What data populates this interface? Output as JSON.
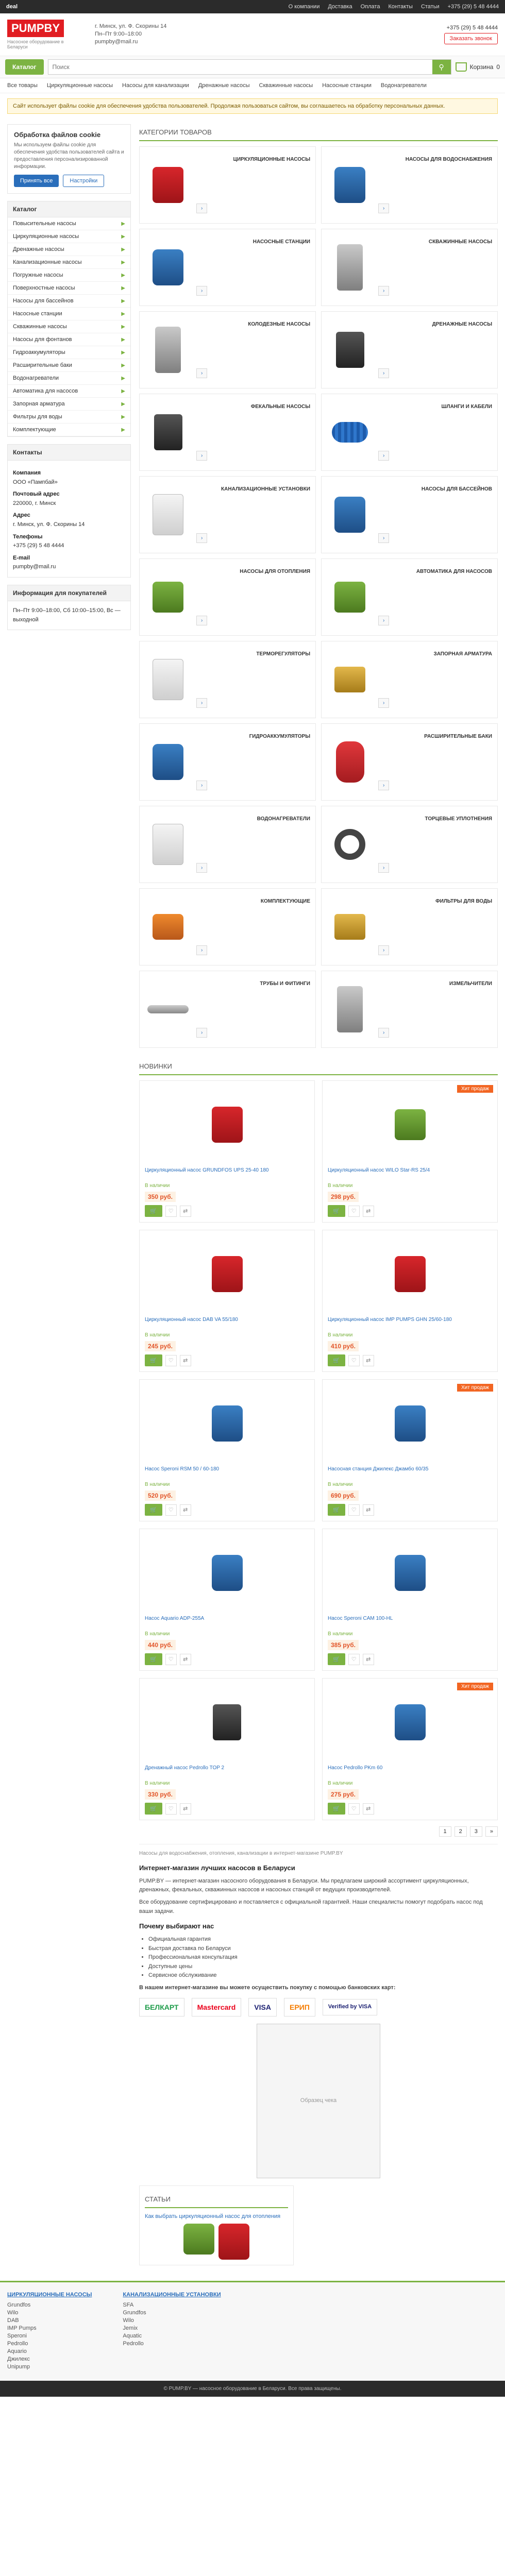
{
  "topbar": {
    "site": "deal",
    "links": [
      "О компании",
      "Доставка",
      "Оплата",
      "Контакты",
      "Статьи"
    ],
    "phone": "+375 (29) 5 48 4444"
  },
  "header": {
    "brand": "PUMPBY",
    "tagline": "Насосное оборудование в Беларуси",
    "contacts": [
      "г. Минск, ул. Ф. Скорины 14",
      "Пн–Пт 9:00–18:00",
      "pumpby@mail.ru"
    ],
    "phone": "+375 (29) 5 48 4444",
    "callback": "Заказать звонок"
  },
  "nav": {
    "catalog": "Каталог",
    "search_placeholder": "Поиск",
    "cart_label": "Корзина",
    "cart_count": "0",
    "menu": [
      "Все товары",
      "Циркуляционные насосы",
      "Насосы для канализации",
      "Дренажные насосы",
      "Скважинные насосы",
      "Насосные станции",
      "Водонагреватели"
    ]
  },
  "notice": "Сайт использует файлы cookie для обеспечения удобства пользователей. Продолжая пользоваться сайтом, вы соглашаетесь на обработку персональных данных.",
  "cookie": {
    "title": "Обработка файлов cookie",
    "text": "Мы используем файлы cookie для обеспечения удобства пользователей сайта и предоставления персонализированной информации.",
    "accept": "Принять все",
    "settings": "Настройки"
  },
  "sidebar": {
    "categories_title": "Каталог",
    "categories": [
      "Повысительные насосы",
      "Циркуляционные насосы",
      "Дренажные насосы",
      "Канализационные насосы",
      "Погружные насосы",
      "Поверхностные насосы",
      "Насосы для бассейнов",
      "Насосные станции",
      "Скважинные насосы",
      "Насосы для фонтанов",
      "Гидроаккумуляторы",
      "Расширительные баки",
      "Водонагреватели",
      "Автоматика для насосов",
      "Запорная арматура",
      "Фильтры для воды",
      "Комплектующие"
    ],
    "contacts_title": "Контакты",
    "contacts": [
      {
        "label": "Компания",
        "value": "ООО «Пампбай»"
      },
      {
        "label": "Почтовый адрес",
        "value": "220000, г. Минск"
      },
      {
        "label": "Адрес",
        "value": "г. Минск, ул. Ф. Скорины 14"
      },
      {
        "label": "Телефоны",
        "value": "+375 (29) 5 48 4444"
      },
      {
        "label": "E-mail",
        "value": "pumpby@mail.ru"
      }
    ],
    "hours_title": "Информация для покупателей",
    "hours_text": "Пн–Пт 9:00–18:00, Сб 10:00–15:00, Вс — выходной"
  },
  "categories_title": "Категории товаров",
  "categories": [
    {
      "name": "Циркуляционные насосы",
      "shape": "shape-pump"
    },
    {
      "name": "Насосы для водоснабжения",
      "shape": "shape-blue"
    },
    {
      "name": "Насосные станции",
      "shape": "shape-blue"
    },
    {
      "name": "Скважинные насосы",
      "shape": "shape-grey"
    },
    {
      "name": "Колодезные насосы",
      "shape": "shape-grey"
    },
    {
      "name": "Дренажные насосы",
      "shape": "shape-dark"
    },
    {
      "name": "Фекальные насосы",
      "shape": "shape-dark"
    },
    {
      "name": "Шланги и кабели",
      "shape": "shape-coil"
    },
    {
      "name": "Канализационные установки",
      "shape": "shape-white"
    },
    {
      "name": "Насосы для бассейнов",
      "shape": "shape-blue"
    },
    {
      "name": "Насосы для отопления",
      "shape": "shape-green"
    },
    {
      "name": "Автоматика для насосов",
      "shape": "shape-green"
    },
    {
      "name": "Терморегуляторы",
      "shape": "shape-white"
    },
    {
      "name": "Запорная арматура",
      "shape": "shape-brass"
    },
    {
      "name": "Гидроаккумуляторы",
      "shape": "shape-blue"
    },
    {
      "name": "Расширительные баки",
      "shape": "shape-red-tank"
    },
    {
      "name": "Водонагреватели",
      "shape": "shape-white"
    },
    {
      "name": "Торцевые уплотнения",
      "shape": "shape-ring"
    },
    {
      "name": "Комплектующие",
      "shape": "shape-orange"
    },
    {
      "name": "Фильтры для воды",
      "shape": "shape-brass"
    },
    {
      "name": "Трубы и фитинги",
      "shape": "shape-pipe"
    },
    {
      "name": "Измельчители",
      "shape": "shape-grey"
    }
  ],
  "products_title": "Новинки",
  "products": [
    {
      "name": "Циркуляционный насос GRUNDFOS UPS 25-40 180",
      "stock": "В наличии",
      "price": "350 руб.",
      "badge": "",
      "shape": "shape-pump"
    },
    {
      "name": "Циркуляционный насос WILO Star-RS 25/4",
      "stock": "В наличии",
      "price": "298 руб.",
      "badge": "Хит продаж",
      "shape": "shape-green"
    },
    {
      "name": "Циркуляционный насос DAB VA 55/180",
      "stock": "В наличии",
      "price": "245 руб.",
      "badge": "",
      "shape": "shape-pump"
    },
    {
      "name": "Циркуляционный насос IMP PUMPS GHN 25/60-180",
      "stock": "В наличии",
      "price": "410 руб.",
      "badge": "",
      "shape": "shape-pump"
    },
    {
      "name": "Насос Speroni RSM 50 / 60-180",
      "stock": "В наличии",
      "price": "520 руб.",
      "badge": "",
      "shape": "shape-blue"
    },
    {
      "name": "Насосная станция Джилекс Джамбо 60/35",
      "stock": "В наличии",
      "price": "690 руб.",
      "badge": "Хит продаж",
      "shape": "shape-blue"
    },
    {
      "name": "Насос Aquario ADP-255A",
      "stock": "В наличии",
      "price": "440 руб.",
      "badge": "",
      "shape": "shape-blue"
    },
    {
      "name": "Насос Speroni CAM 100-HL",
      "stock": "В наличии",
      "price": "385 руб.",
      "badge": "",
      "shape": "shape-blue"
    },
    {
      "name": "Дренажный насос Pedrollo TOP 2",
      "stock": "В наличии",
      "price": "330 руб.",
      "badge": "",
      "shape": "shape-dark"
    },
    {
      "name": "Насос Pedrollo PKm 60",
      "stock": "В наличии",
      "price": "275 руб.",
      "badge": "Хит продаж",
      "shape": "shape-blue"
    }
  ],
  "pager": [
    "1",
    "2",
    "3",
    "»"
  ],
  "about": {
    "breadcrumb": "Насосы для водоснабжения, отопления, канализации в интернет-магазине PUMP.BY",
    "heading": "Интернет-магазин лучших насосов в Беларуси",
    "paragraphs": [
      "PUMP.BY — интернет-магазин насосного оборудования в Беларуси. Мы предлагаем широкий ассортимент циркуляционных, дренажных, фекальных, скважинных насосов и насосных станций от ведущих производителей.",
      "Все оборудование сертифицировано и поставляется с официальной гарантией. Наши специалисты помогут подобрать насос под ваши задачи."
    ],
    "subheading": "Почему выбирают нас",
    "list": [
      "Официальная гарантия",
      "Быстрая доставка по Беларуси",
      "Профессиональная консультация",
      "Доступные цены",
      "Сервисное обслуживание"
    ],
    "payment_title": "В нашем интернет-магазине вы можете осуществить покупку с помощью банковских карт:",
    "payment_logos": [
      "БЕЛКАРТ",
      "Mastercard",
      "VISA",
      "ЕРИП",
      "Verified by VISA"
    ],
    "receipt_caption": "Образец чека"
  },
  "news": {
    "title": "Статьи",
    "item": "Как выбрать циркуляционный насос для отопления"
  },
  "footer": {
    "col1_title": "Циркуляционные насосы",
    "col1": [
      "Grundfos",
      "Wilo",
      "DAB",
      "IMP Pumps",
      "Speroni",
      "Pedrollo",
      "Aquario",
      "Джилекс",
      "Unipump"
    ],
    "col2_title": "Канализационные установки",
    "col2": [
      "SFA",
      "Grundfos",
      "Wilo",
      "Jemix",
      "Aquatic",
      "Pedrollo"
    ]
  },
  "copyright": "© PUMP.BY — насосное оборудование в Беларуси. Все права защищены."
}
